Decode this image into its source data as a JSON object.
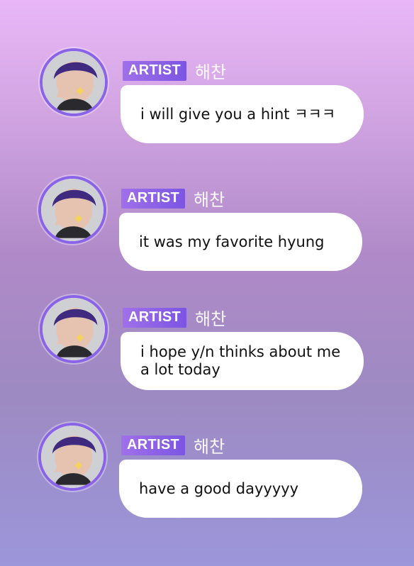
{
  "messages": [
    {
      "badge": "ARTIST",
      "name": "해찬",
      "text": "i will give you a hint ㅋㅋㅋ"
    },
    {
      "badge": "ARTIST",
      "name": "해찬",
      "text": "it was my favorite hyung"
    },
    {
      "badge": "ARTIST",
      "name": "해찬",
      "text": "i hope y/n thinks about me a lot today"
    },
    {
      "badge": "ARTIST",
      "name": "해찬",
      "text": "have a good dayyyyy"
    }
  ],
  "colors": {
    "badge_start": "#a070ea",
    "badge_end": "#7b55e3",
    "avatar_ring": "#8a63e8",
    "bubble_bg": "#ffffff"
  },
  "icons": {
    "avatar": "profile-photo"
  }
}
